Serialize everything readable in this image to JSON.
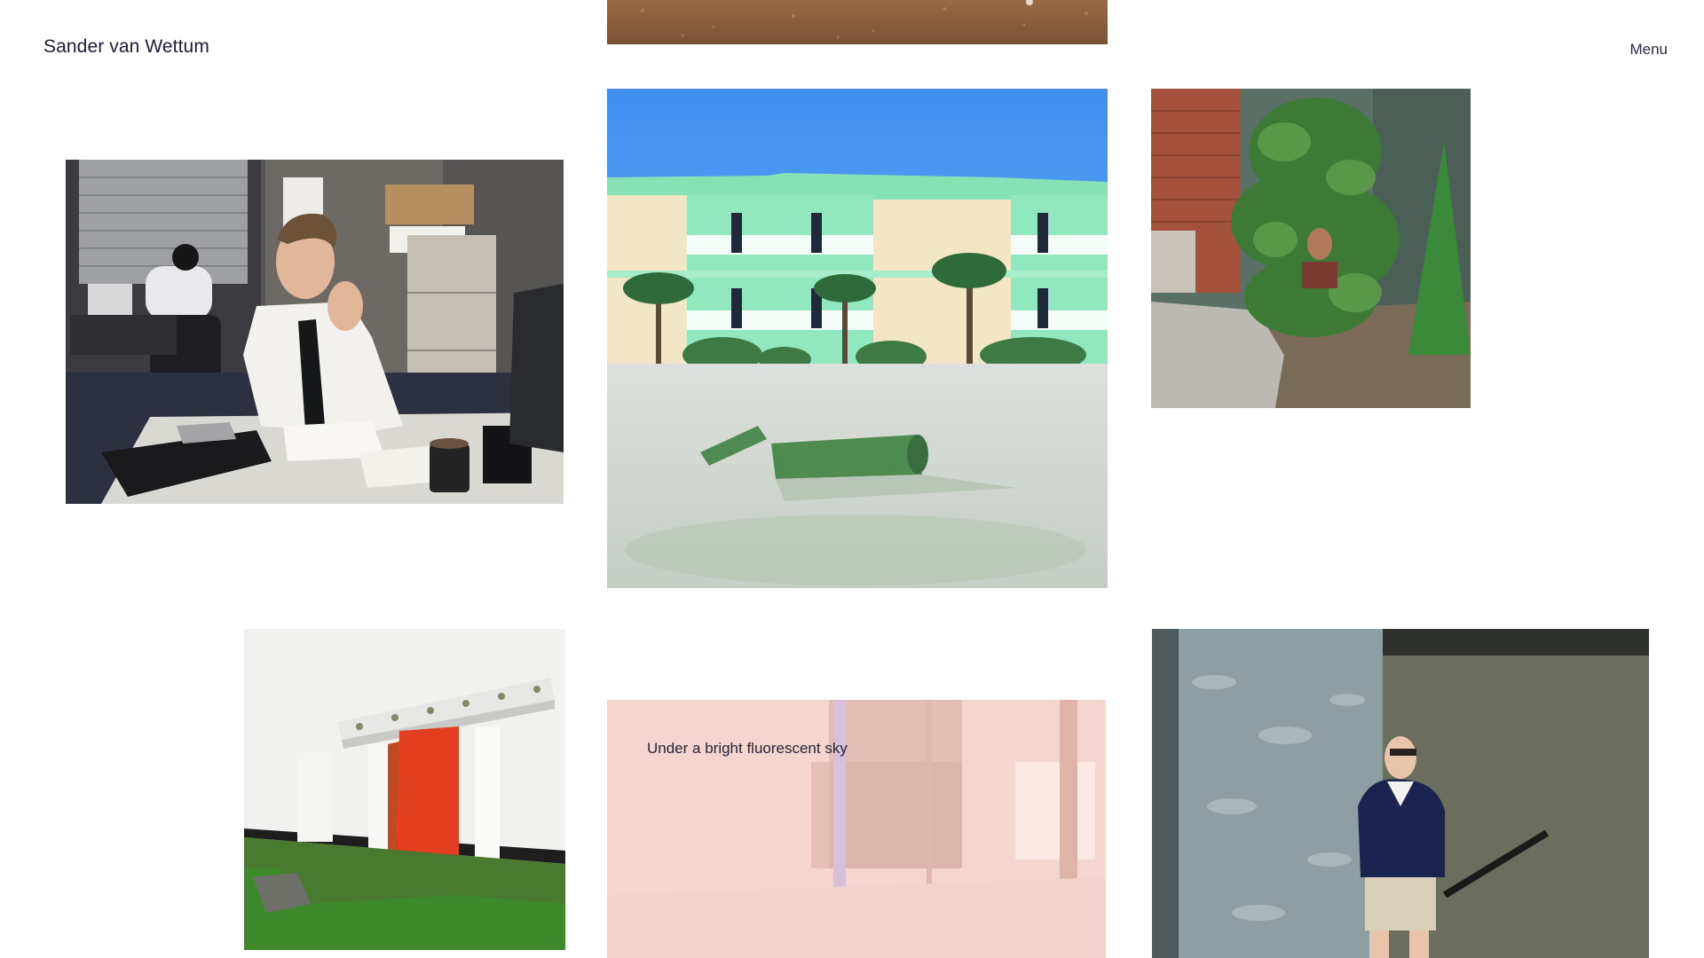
{
  "header": {
    "site_title": "Sander van Wettum",
    "menu_label": "Menu"
  },
  "gallery": {
    "items": [
      {
        "name": "desert-photo"
      },
      {
        "name": "office-worker-photo"
      },
      {
        "name": "green-hotel-photo"
      },
      {
        "name": "person-in-bush-photo"
      },
      {
        "name": "red-door-photo"
      },
      {
        "name": "mall-interior-photo",
        "caption": "Under a bright fluorescent sky"
      },
      {
        "name": "old-man-sunglasses-photo"
      }
    ]
  },
  "colors": {
    "text": "#1c1c3a",
    "background": "#ffffff",
    "caption_overlay": "#f7d9d2"
  }
}
